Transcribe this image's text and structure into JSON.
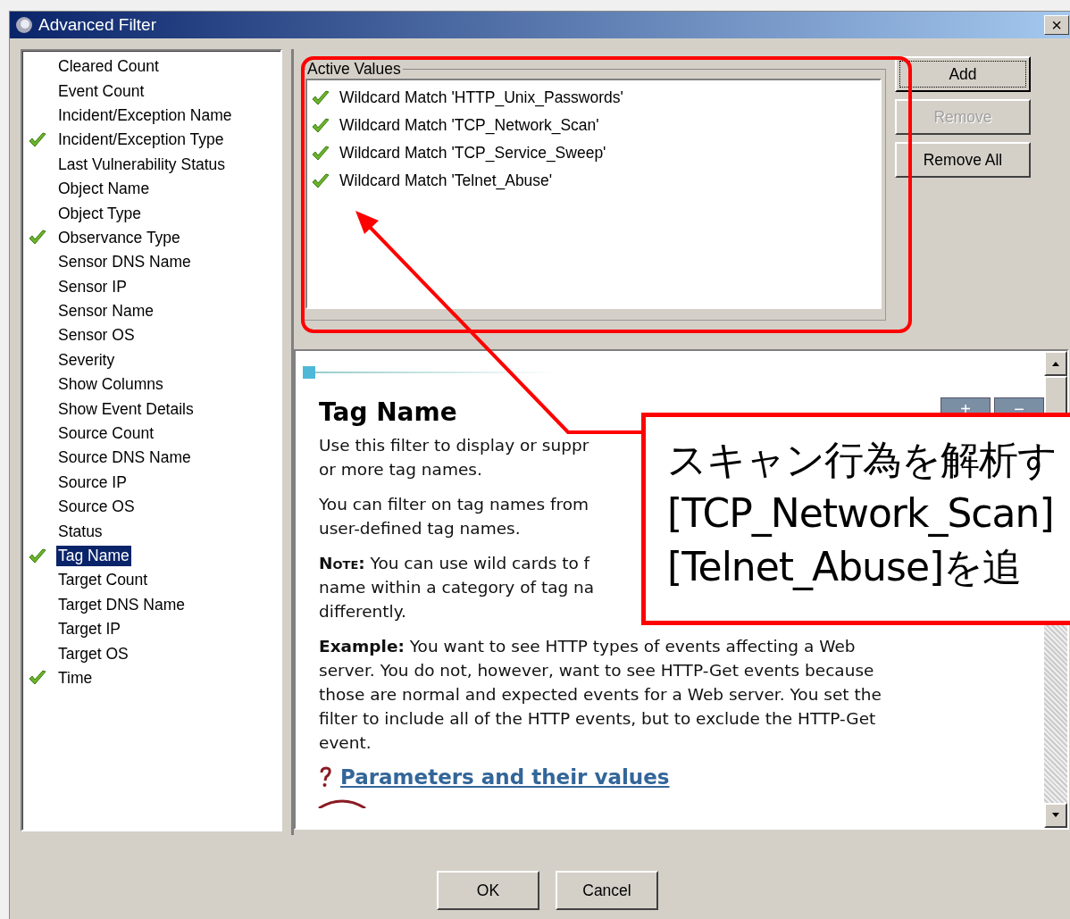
{
  "window": {
    "title": "Advanced Filter",
    "close": "×"
  },
  "filters": [
    {
      "label": "Cleared Count",
      "checked": false,
      "selected": false
    },
    {
      "label": "Event Count",
      "checked": false,
      "selected": false
    },
    {
      "label": "Incident/Exception Name",
      "checked": false,
      "selected": false
    },
    {
      "label": "Incident/Exception Type",
      "checked": true,
      "selected": false
    },
    {
      "label": "Last Vulnerability Status",
      "checked": false,
      "selected": false
    },
    {
      "label": "Object Name",
      "checked": false,
      "selected": false
    },
    {
      "label": "Object Type",
      "checked": false,
      "selected": false
    },
    {
      "label": "Observance Type",
      "checked": true,
      "selected": false
    },
    {
      "label": "Sensor DNS Name",
      "checked": false,
      "selected": false
    },
    {
      "label": "Sensor IP",
      "checked": false,
      "selected": false
    },
    {
      "label": "Sensor Name",
      "checked": false,
      "selected": false
    },
    {
      "label": "Sensor OS",
      "checked": false,
      "selected": false
    },
    {
      "label": "Severity",
      "checked": false,
      "selected": false
    },
    {
      "label": "Show Columns",
      "checked": false,
      "selected": false
    },
    {
      "label": "Show Event Details",
      "checked": false,
      "selected": false
    },
    {
      "label": "Source Count",
      "checked": false,
      "selected": false
    },
    {
      "label": "Source DNS Name",
      "checked": false,
      "selected": false
    },
    {
      "label": "Source IP",
      "checked": false,
      "selected": false
    },
    {
      "label": "Source OS",
      "checked": false,
      "selected": false
    },
    {
      "label": "Status",
      "checked": false,
      "selected": false
    },
    {
      "label": "Tag Name",
      "checked": true,
      "selected": true
    },
    {
      "label": "Target Count",
      "checked": false,
      "selected": false
    },
    {
      "label": "Target DNS Name",
      "checked": false,
      "selected": false
    },
    {
      "label": "Target IP",
      "checked": false,
      "selected": false
    },
    {
      "label": "Target OS",
      "checked": false,
      "selected": false
    },
    {
      "label": "Time",
      "checked": true,
      "selected": false
    }
  ],
  "active_values": {
    "title": "Active Values",
    "items": [
      {
        "label": "Wildcard Match 'HTTP_Unix_Passwords'"
      },
      {
        "label": "Wildcard Match 'TCP_Network_Scan'"
      },
      {
        "label": "Wildcard Match 'TCP_Service_Sweep'"
      },
      {
        "label": "Wildcard Match 'Telnet_Abuse'"
      }
    ]
  },
  "value_buttons": [
    {
      "label": "Add",
      "disabled": false
    },
    {
      "label": "Remove",
      "disabled": true
    },
    {
      "label": "Remove All",
      "disabled": false
    }
  ],
  "help": {
    "title": "Tag Name",
    "nav_buttons": [
      "+",
      "−"
    ],
    "paragraphs": [
      {
        "kind": "text",
        "lines": [
          "Use this filter to display or suppr",
          "or more tag names."
        ]
      },
      {
        "kind": "text",
        "lines": [
          "You can filter on tag names from",
          "user-defined tag names."
        ]
      },
      {
        "kind": "note",
        "lead": "Note:",
        "lines": [
          "You can use wild cards to f",
          "name within a category of tag na",
          "differently."
        ]
      },
      {
        "kind": "note",
        "lead": "Example:",
        "lines": [
          "You want to see HTTP types of events affecting a Web",
          "server. You do not, however, want to see HTTP-Get events because",
          "those are normal and expected events for a Web server. You set the",
          "filter to include all of the HTTP events, but to exclude the HTTP-Get",
          "event."
        ]
      }
    ],
    "link": "Parameters and their values"
  },
  "dialog_buttons": [
    "OK",
    "Cancel"
  ],
  "callout": {
    "lines": [
      "スキャン行為を解析す",
      "[TCP_Network_Scan]",
      "[Telnet_Abuse]を追"
    ]
  }
}
